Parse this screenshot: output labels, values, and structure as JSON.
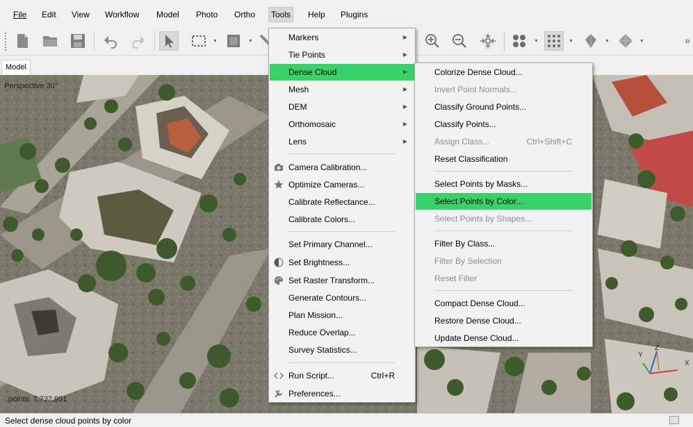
{
  "menubar": [
    {
      "label": "File",
      "active": false
    },
    {
      "label": "Edit",
      "active": false
    },
    {
      "label": "View",
      "active": false
    },
    {
      "label": "Workflow",
      "active": false
    },
    {
      "label": "Model",
      "active": false
    },
    {
      "label": "Photo",
      "active": false
    },
    {
      "label": "Ortho",
      "active": false
    },
    {
      "label": "Tools",
      "active": true
    },
    {
      "label": "Help",
      "active": false
    },
    {
      "label": "Plugins",
      "active": false
    }
  ],
  "toolbar": {
    "left_tools": [
      "new-document-icon",
      "open-folder-icon",
      "save-icon",
      "undo-icon",
      "redo-icon",
      "navigation-cursor-icon",
      "rectangle-selection-icon",
      "resize-region-icon"
    ],
    "right_tools": [
      "zoom-in-icon",
      "zoom-out-icon",
      "move-center-icon",
      "show-cameras-icon",
      "point-cloud-icon",
      "dense-cloud-icon",
      "mesh-icon"
    ],
    "overflow": "»"
  },
  "tab": {
    "label": "Model"
  },
  "viewport": {
    "perspective_label": "Perspective 30°",
    "points_label": "points: 7,732,991",
    "axes": {
      "x": "X",
      "y": "Y",
      "z": "Z"
    }
  },
  "tools_menu": {
    "items": [
      {
        "label": "Markers",
        "submenu": true,
        "icon": ""
      },
      {
        "label": "Tie Points",
        "submenu": true,
        "icon": ""
      },
      {
        "label": "Dense Cloud",
        "submenu": true,
        "highlighted": true,
        "icon": ""
      },
      {
        "label": "Mesh",
        "submenu": true,
        "icon": ""
      },
      {
        "label": "DEM",
        "submenu": true,
        "icon": ""
      },
      {
        "label": "Orthomosaic",
        "submenu": true,
        "icon": ""
      },
      {
        "label": "Lens",
        "submenu": true,
        "icon": ""
      },
      {
        "separator": true
      },
      {
        "label": "Camera Calibration...",
        "icon": "camera-icon"
      },
      {
        "label": "Optimize Cameras...",
        "icon": "star-icon"
      },
      {
        "label": "Calibrate Reflectance...",
        "icon": ""
      },
      {
        "label": "Calibrate Colors...",
        "icon": ""
      },
      {
        "separator": true
      },
      {
        "label": "Set Primary Channel...",
        "icon": ""
      },
      {
        "label": "Set Brightness...",
        "icon": "brightness-icon"
      },
      {
        "label": "Set Raster Transform...",
        "icon": "palette-icon"
      },
      {
        "label": "Generate Contours...",
        "icon": ""
      },
      {
        "label": "Plan Mission...",
        "icon": ""
      },
      {
        "label": "Reduce Overlap...",
        "icon": ""
      },
      {
        "label": "Survey Statistics...",
        "icon": ""
      },
      {
        "separator": true
      },
      {
        "label": "Run Script...",
        "shortcut": "Ctrl+R",
        "icon": "code-icon"
      },
      {
        "label": "Preferences...",
        "icon": "wrench-icon"
      }
    ]
  },
  "dense_cloud_menu": {
    "items": [
      {
        "label": "Colorize Dense Cloud...",
        "disabled": false
      },
      {
        "label": "Invert Point Normals...",
        "disabled": true
      },
      {
        "label": "Classify Ground Points...",
        "disabled": false
      },
      {
        "label": "Classify Points...",
        "disabled": false
      },
      {
        "label": "Assign Class...",
        "shortcut": "Ctrl+Shift+C",
        "disabled": true
      },
      {
        "label": "Reset Classification",
        "disabled": false
      },
      {
        "separator": true
      },
      {
        "label": "Select Points by Masks...",
        "disabled": false
      },
      {
        "label": "Select Points by Color...",
        "disabled": false,
        "highlighted": true
      },
      {
        "label": "Select Points by Shapes...",
        "disabled": true
      },
      {
        "separator": true
      },
      {
        "label": "Filter By Class...",
        "disabled": false
      },
      {
        "label": "Filter By Selection",
        "disabled": true
      },
      {
        "label": "Reset Filter",
        "disabled": true
      },
      {
        "separator": true
      },
      {
        "label": "Compact Dense Cloud...",
        "disabled": false
      },
      {
        "label": "Restore Dense Cloud...",
        "disabled": false
      },
      {
        "label": "Update Dense Cloud...",
        "disabled": false
      }
    ]
  },
  "status": {
    "text": "Select dense cloud points by color"
  },
  "colors": {
    "highlight": "#37d26a",
    "menu_bg": "#f2f2f2"
  }
}
